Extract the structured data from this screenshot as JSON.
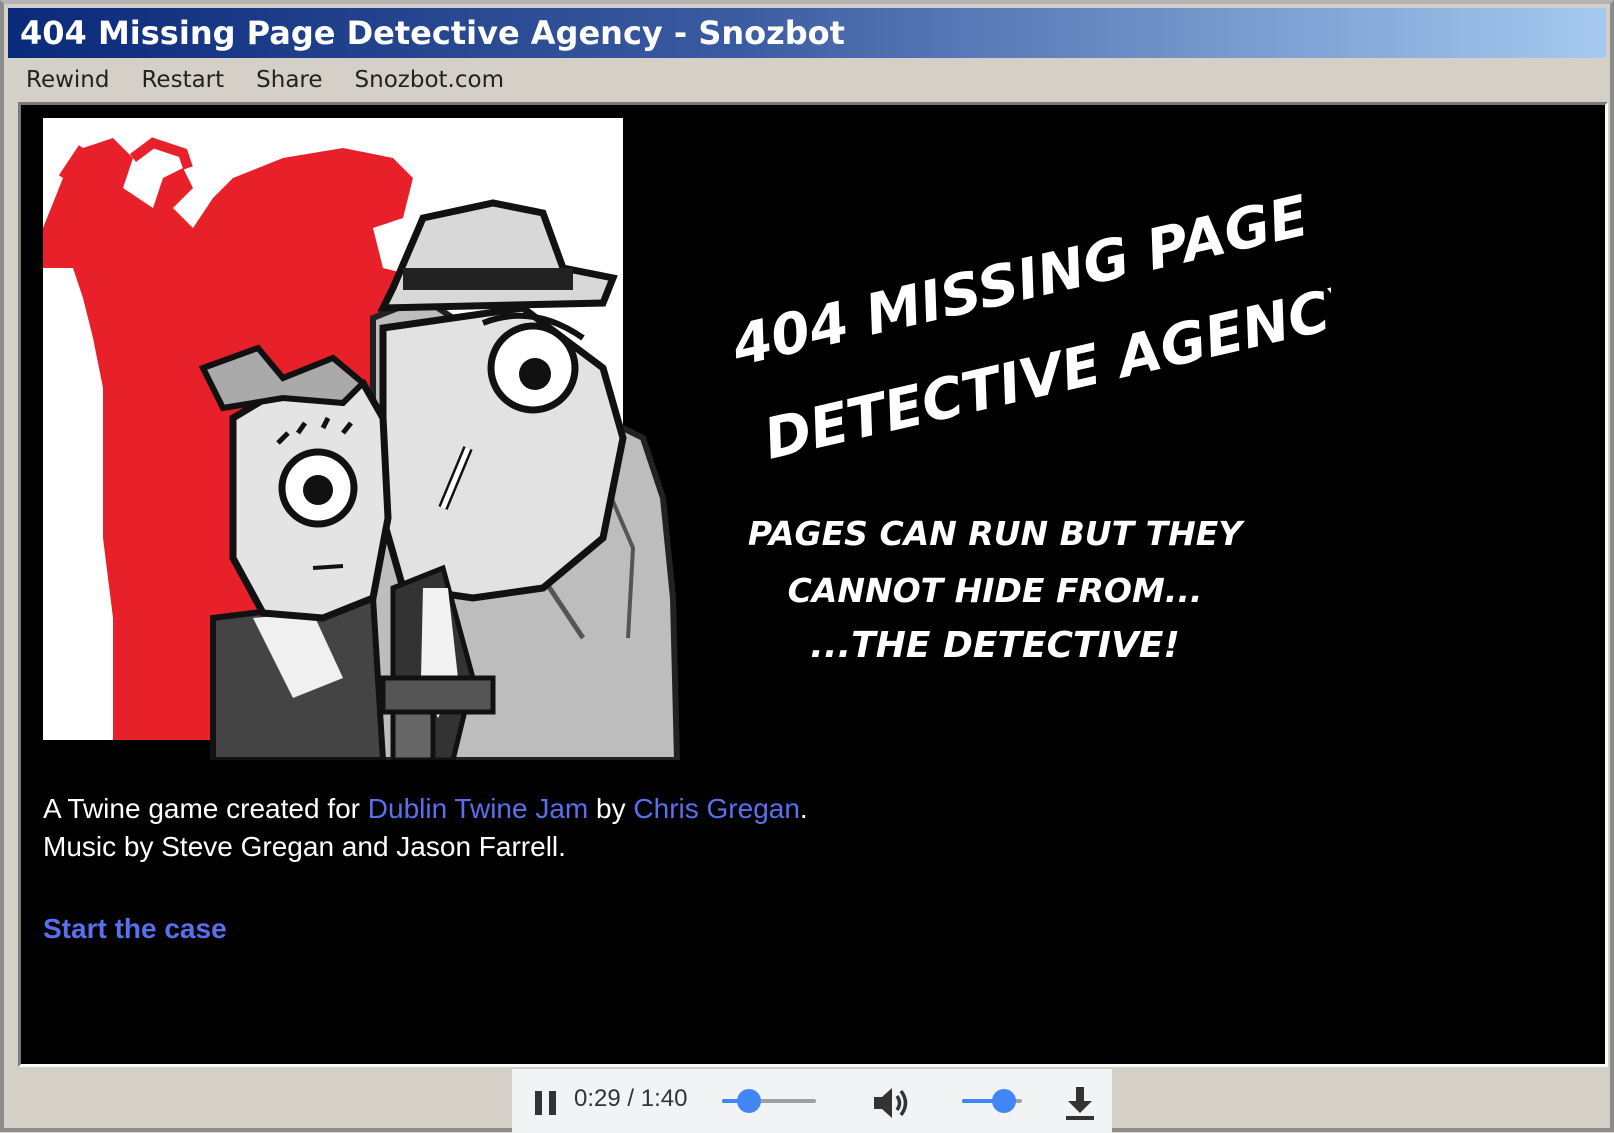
{
  "window": {
    "title": "404 Missing Page Detective Agency - Snozbot"
  },
  "menu": {
    "items": [
      "Rewind",
      "Restart",
      "Share",
      "Snozbot.com"
    ]
  },
  "game": {
    "title_art_lines": [
      "404 MISSING PAGE",
      "DETECTIVE AGENCY!"
    ],
    "tagline_lines": [
      "PAGES CAN RUN BUT THEY",
      "CANNOT HIDE FROM...",
      "...THE DETECTIVE!"
    ],
    "credits": {
      "line1_prefix": "A Twine game created for ",
      "line1_link1": "Dublin Twine Jam",
      "line1_mid": " by ",
      "line1_link2": "Chris Gregan",
      "line1_suffix": ".",
      "line2": "Music by Steve Gregan and Jason Farrell."
    },
    "start_link": "Start the case"
  },
  "audio": {
    "time_display": "0:29 / 1:40",
    "progress": 0.29,
    "volume": 0.7,
    "accent_color": "#4285f4",
    "icons": [
      "pause-icon",
      "volume-icon",
      "download-icon"
    ]
  },
  "colors": {
    "link": "#5a6ff0",
    "art_red": "#e8202a",
    "game_bg": "#000000"
  }
}
